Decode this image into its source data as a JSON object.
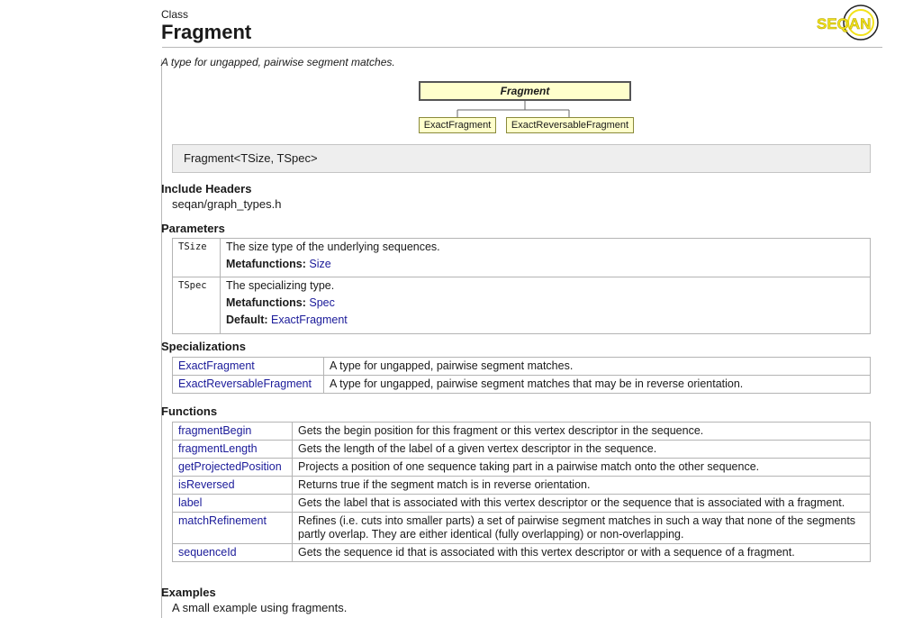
{
  "header": {
    "kind": "Class",
    "title": "Fragment",
    "logo_text": "SEQAN",
    "summary": "A type for ungapped, pairwise segment matches."
  },
  "diagram": {
    "root": "Fragment",
    "children": [
      "ExactFragment",
      "ExactReversableFragment"
    ]
  },
  "signature": "Fragment<TSize, TSpec>",
  "include": {
    "heading": "Include Headers",
    "file": "seqan/graph_types.h"
  },
  "parameters": {
    "heading": "Parameters",
    "metafunctions_label": "Metafunctions:",
    "default_label": "Default:",
    "rows": [
      {
        "name": "TSize",
        "desc": "The size type of the underlying sequences.",
        "metafunction": "Size"
      },
      {
        "name": "TSpec",
        "desc": "The specializing type.",
        "metafunction": "Spec",
        "default": "ExactFragment"
      }
    ]
  },
  "specializations": {
    "heading": "Specializations",
    "rows": [
      {
        "name": "ExactFragment",
        "desc": "A type for ungapped, pairwise segment matches."
      },
      {
        "name": "ExactReversableFragment",
        "desc": "A type for ungapped, pairwise segment matches that may be in reverse orientation."
      }
    ]
  },
  "functions": {
    "heading": "Functions",
    "rows": [
      {
        "name": "fragmentBegin",
        "desc": "Gets the begin position for this fragment or this vertex descriptor in the sequence."
      },
      {
        "name": "fragmentLength",
        "desc": "Gets the length of the label of a given vertex descriptor in the sequence."
      },
      {
        "name": "getProjectedPosition",
        "desc": "Projects a position of one sequence taking part in a pairwise match onto the other sequence."
      },
      {
        "name": "isReversed",
        "desc": "Returns true if the segment match is in reverse orientation."
      },
      {
        "name": "label",
        "desc": "Gets the label that is associated with this vertex descriptor or the sequence that is associated with a fragment."
      },
      {
        "name": "matchRefinement",
        "desc": "Refines (i.e. cuts into smaller parts) a set of pairwise segment matches in such a way that none of the segments partly overlap. They are either identical (fully overlapping) or non-overlapping."
      },
      {
        "name": "sequenceId",
        "desc": "Gets the sequence id that is associated with this vertex descriptor or with a sequence of a fragment."
      }
    ]
  },
  "examples": {
    "heading": "Examples",
    "text": "A small example using fragments."
  },
  "colors": {
    "link": "#1a1a99",
    "diagram_fill": "#ffffcc",
    "signature_bg": "#eeeeee",
    "logo_yellow": "#f2e21a"
  }
}
